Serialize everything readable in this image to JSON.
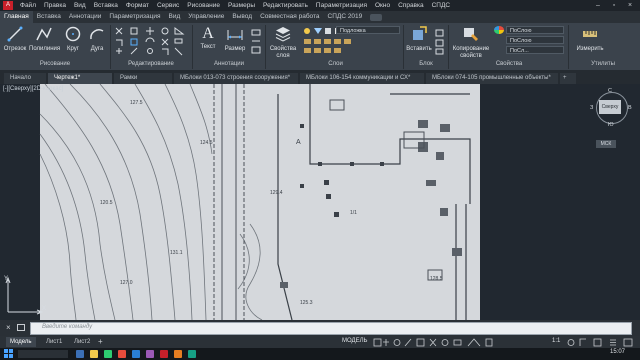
{
  "menu": {
    "items": [
      "Файл",
      "Правка",
      "Вид",
      "Вставка",
      "Формат",
      "Сервис",
      "Рисование",
      "Размеры",
      "Редактировать",
      "Параметризация",
      "Окно",
      "Справка",
      "СПДС"
    ]
  },
  "ribbon_tabs": [
    "Главная",
    "Вставка",
    "Аннотации",
    "Параметризация",
    "Вид",
    "Управление",
    "Вывод",
    "Совместная работа",
    "СПДС 2019"
  ],
  "ribbon": {
    "draw_tools": [
      "Отрезок",
      "Полилиния",
      "Круг",
      "Дуга"
    ],
    "panels": {
      "draw": "Рисование",
      "modify": "Редактирование",
      "annotation": "Аннотации",
      "layers": "Слои",
      "block": "Блок",
      "properties": "Свойства",
      "utilities": "Утилиты"
    },
    "text_button": "Текст",
    "dimension_button": "Размер",
    "layer_props_button": "Свойства слоя",
    "insert_button": "Вставить",
    "match_props_button": "Копирование свойств",
    "measure_button": "Измерить",
    "layer_dropdown": "Подложка",
    "bylayer_color": "ПоСлою",
    "bylayer_linetype": "ПоСлою",
    "bylayer_lineweight": "ПоСл..."
  },
  "file_tabs": [
    {
      "label": "Начало",
      "active": false
    },
    {
      "label": "Чертеж1*",
      "active": true
    },
    {
      "label": "Рамки",
      "active": false
    },
    {
      "label": "МБлоки 013-073 строения сооружения*",
      "active": false
    },
    {
      "label": "МБлоки 106-154 коммуникации и СХ*",
      "active": false
    },
    {
      "label": "МБлоки 074-105 промышленные объекты*",
      "active": false
    }
  ],
  "viewport_label": "[-][Сверху][2D-каркас]",
  "viewcube": {
    "top": "Сверху",
    "north": "С",
    "south": "Ю",
    "west": "З",
    "east": "В",
    "wcs": "МСК"
  },
  "map_labels": [
    "A",
    "127.5",
    "124.5",
    "129.4",
    "131.1",
    "125.3",
    "120.5",
    "127.0",
    "128.5",
    "1/1"
  ],
  "command": {
    "placeholder": "Введите команду"
  },
  "layout_tabs": [
    {
      "label": "Модель",
      "active": true
    },
    {
      "label": "Лист1",
      "active": false
    },
    {
      "label": "Лист2",
      "active": false
    }
  ],
  "status": {
    "mode": "МОДЕЛЬ",
    "scale": "1:1"
  },
  "clock": {
    "time": "15:07"
  },
  "colors": {
    "accent": "#2a7fd4",
    "background": "#212830",
    "ribbon": "#3b434c"
  }
}
